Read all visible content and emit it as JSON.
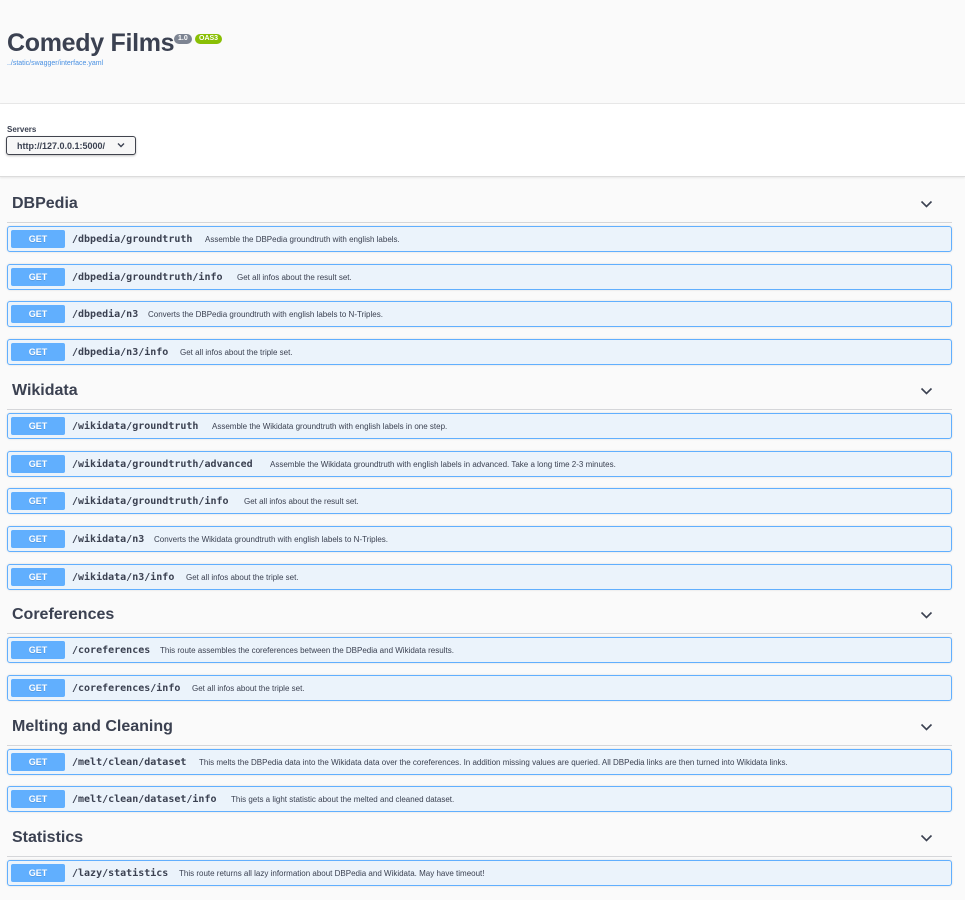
{
  "header": {
    "title": "Comedy Films",
    "version": "1.0",
    "oas": "OAS3",
    "spec_link": "../static/swagger/interface.yaml"
  },
  "servers": {
    "label": "Servers",
    "selected": "http://127.0.0.1:5000/"
  },
  "colors": {
    "get": "#61affe",
    "get_bg": "#ebf3fb",
    "version_badge": "#7d8492",
    "oas_badge": "#89bf04",
    "link": "#4990e2"
  },
  "sections": [
    {
      "name": "DBPedia",
      "ops": [
        {
          "method": "GET",
          "path": "/dbpedia/groundtruth",
          "desc": "Assemble the DBPedia groundtruth with english labels."
        },
        {
          "method": "GET",
          "path": "/dbpedia/groundtruth/info",
          "desc": "Get all infos about the result set."
        },
        {
          "method": "GET",
          "path": "/dbpedia/n3",
          "desc": "Converts the DBPedia groundtruth with english labels to N-Triples."
        },
        {
          "method": "GET",
          "path": "/dbpedia/n3/info",
          "desc": "Get all infos about the triple set."
        }
      ]
    },
    {
      "name": "Wikidata",
      "ops": [
        {
          "method": "GET",
          "path": "/wikidata/groundtruth",
          "desc": "Assemble the Wikidata groundtruth with english labels in one step."
        },
        {
          "method": "GET",
          "path": "/wikidata/groundtruth/advanced",
          "desc": "Assemble the Wikidata groundtruth with english labels in advanced. Take a long time 2-3 minutes."
        },
        {
          "method": "GET",
          "path": "/wikidata/groundtruth/info",
          "desc": "Get all infos about the result set."
        },
        {
          "method": "GET",
          "path": "/wikidata/n3",
          "desc": "Converts the Wikidata groundtruth with english labels to N-Triples."
        },
        {
          "method": "GET",
          "path": "/wikidata/n3/info",
          "desc": "Get all infos about the triple set."
        }
      ]
    },
    {
      "name": "Coreferences",
      "ops": [
        {
          "method": "GET",
          "path": "/coreferences",
          "desc": "This route assembles the coreferences between the DBPedia and Wikidata results."
        },
        {
          "method": "GET",
          "path": "/coreferences/info",
          "desc": "Get all infos about the triple set."
        }
      ]
    },
    {
      "name": "Melting and Cleaning",
      "ops": [
        {
          "method": "GET",
          "path": "/melt/clean/dataset",
          "desc": "This melts the DBPedia data into the Wikidata data over the coreferences. In addition missing values are queried. All DBPedia links are then turned into Wikidata links."
        },
        {
          "method": "GET",
          "path": "/melt/clean/dataset/info",
          "desc": "This gets a light statistic about the melted and cleaned dataset."
        }
      ]
    },
    {
      "name": "Statistics",
      "ops": [
        {
          "method": "GET",
          "path": "/lazy/statistics",
          "desc": "This route returns all lazy information about DBPedia and Wikidata. May have timeout!"
        }
      ]
    }
  ]
}
